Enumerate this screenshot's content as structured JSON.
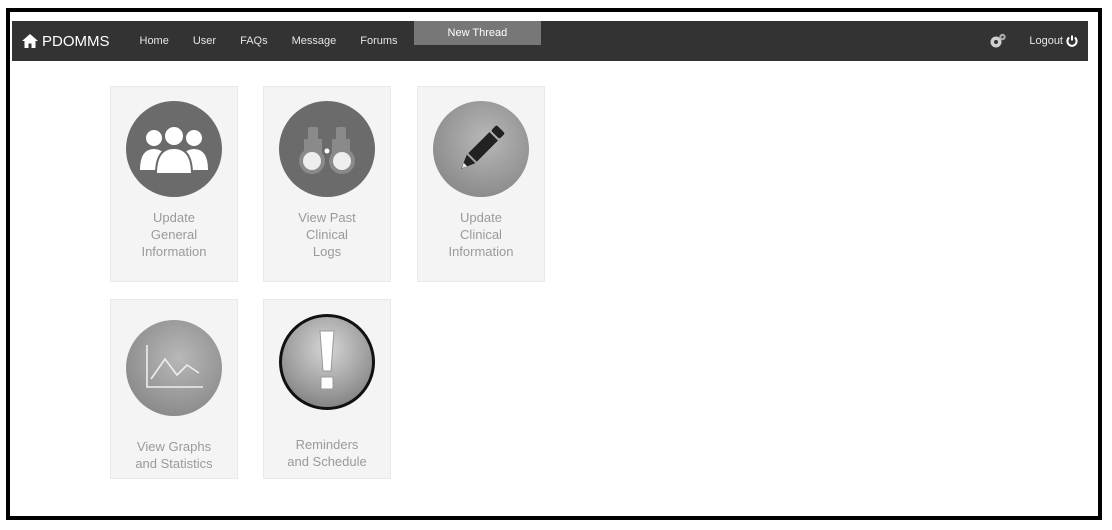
{
  "navbar": {
    "brand": "PDOMMS",
    "items": [
      {
        "label": "Home"
      },
      {
        "label": "User"
      },
      {
        "label": "FAQs"
      },
      {
        "label": "Message"
      },
      {
        "label": "Forums"
      },
      {
        "label": "New Thread",
        "active": true
      }
    ],
    "logout_label": "Logout"
  },
  "tiles": [
    {
      "label_lines": [
        "Update",
        "General",
        "Information"
      ],
      "icon": "users-icon"
    },
    {
      "label_lines": [
        "View Past",
        "Clinical",
        "Logs"
      ],
      "icon": "binoculars-icon"
    },
    {
      "label_lines": [
        "Update",
        "Clinical",
        "Information"
      ],
      "icon": "pencil-icon"
    },
    {
      "label_lines": [
        "View Graphs",
        "and Statistics"
      ],
      "icon": "line-graph-icon"
    },
    {
      "label_lines": [
        "Reminders",
        "and Schedule"
      ],
      "icon": "exclamation-icon"
    }
  ],
  "colors": {
    "navbar_bg": "#333333",
    "active_tab_bg": "#777777",
    "tile_bg": "#f4f4f4",
    "label_text": "#9a9a9a"
  }
}
